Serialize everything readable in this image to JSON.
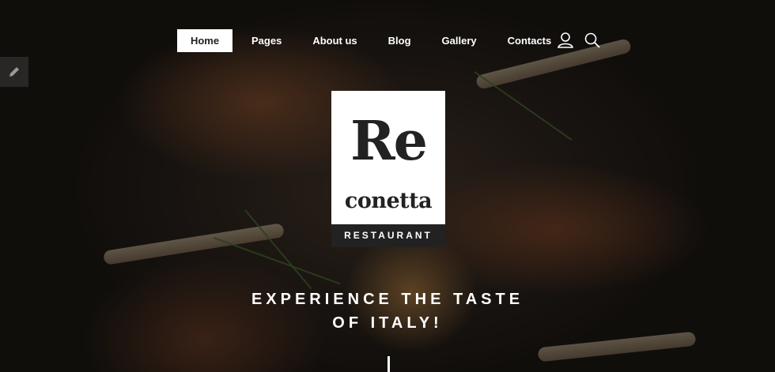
{
  "nav": {
    "items": [
      {
        "label": "Home",
        "active": true
      },
      {
        "label": "Pages",
        "active": false
      },
      {
        "label": "About us",
        "active": false
      },
      {
        "label": "Blog",
        "active": false
      },
      {
        "label": "Gallery",
        "active": false
      },
      {
        "label": "Contacts",
        "active": false
      }
    ],
    "icons": [
      "user-icon",
      "search-icon"
    ]
  },
  "sidebar": {
    "edit_icon": "pencil-icon"
  },
  "logo": {
    "line1": "Re",
    "line2": "conetta",
    "subtitle": "RESTAURANT"
  },
  "hero": {
    "tagline_line1": "EXPERIENCE THE TASTE",
    "tagline_line2": "OF ITALY!"
  },
  "colors": {
    "nav_active_bg": "#ffffff",
    "text_light": "#ffffff",
    "logo_dark": "#222222"
  }
}
